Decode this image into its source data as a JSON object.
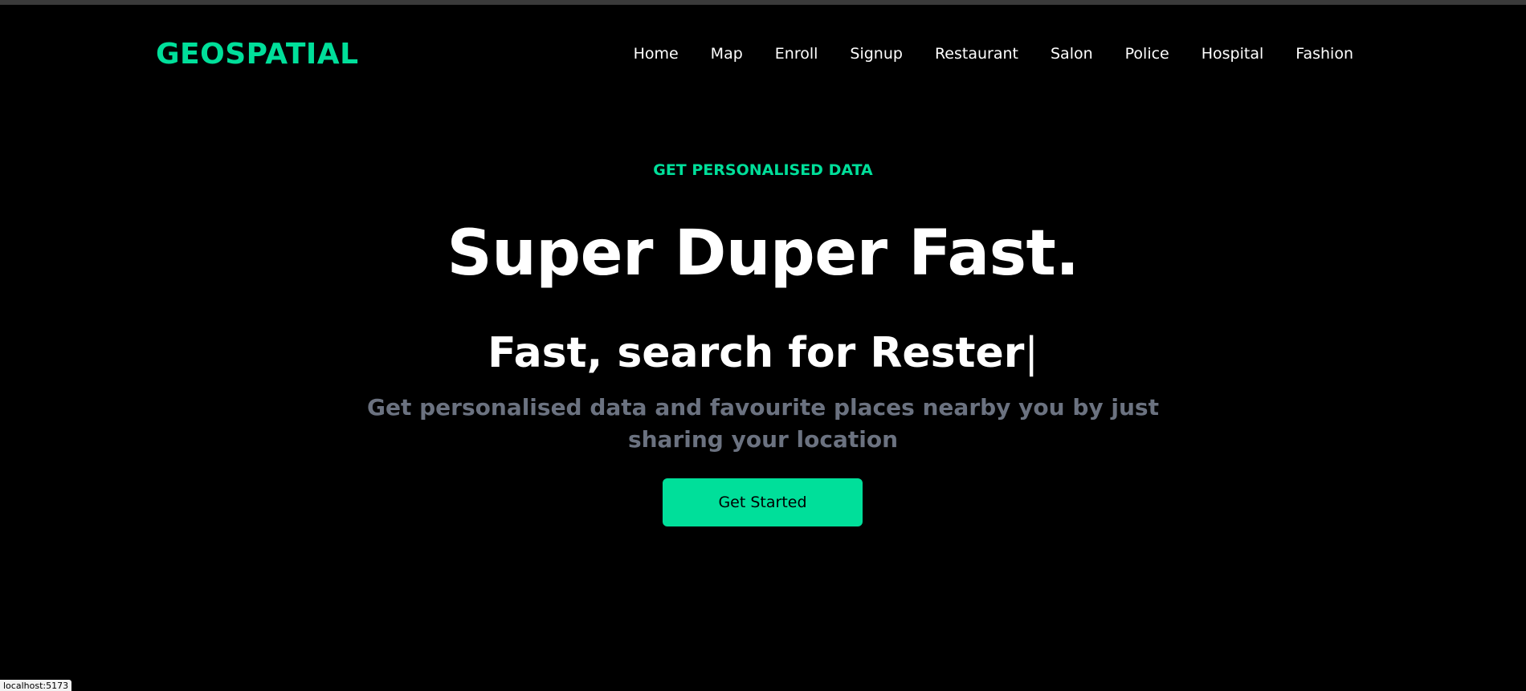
{
  "brand": {
    "logo_text": "GEOSPATIAL",
    "accent_color": "#00df9a"
  },
  "nav": {
    "items": [
      {
        "label": "Home"
      },
      {
        "label": "Map"
      },
      {
        "label": "Enroll"
      },
      {
        "label": "Signup"
      },
      {
        "label": "Restaurant"
      },
      {
        "label": "Salon"
      },
      {
        "label": "Police"
      },
      {
        "label": "Hospital"
      },
      {
        "label": "Fashion"
      }
    ]
  },
  "hero": {
    "eyebrow": "GET PERSONALISED DATA",
    "headline": "Super Duper Fast.",
    "typing_prefix": "Fast, search for ",
    "typing_word": "Rester",
    "typing_caret": "|",
    "description": "Get personalised data and favourite places nearby you by just sharing your location",
    "cta_label": "Get Started"
  },
  "status_bar": {
    "url": "localhost:5173"
  }
}
